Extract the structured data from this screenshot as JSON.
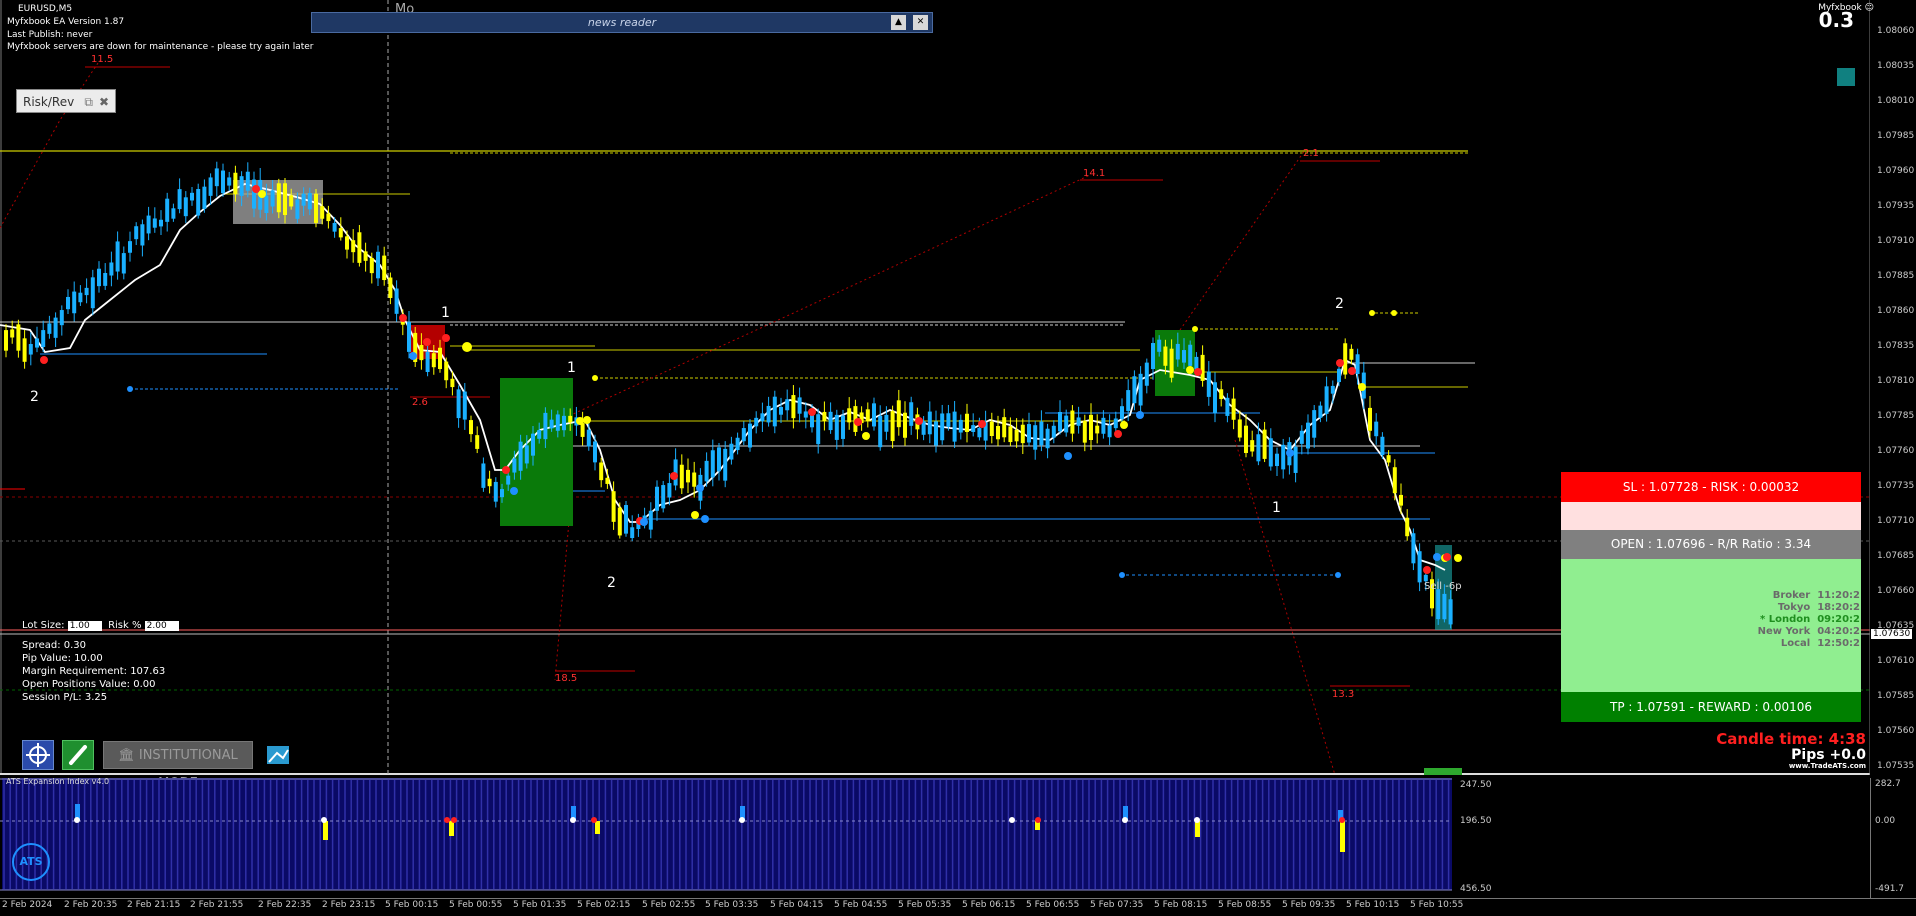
{
  "chart": {
    "symbol_label": "EURUSD,M5",
    "ea_version": "Myfxbook EA Version 1.87",
    "last_publish": "Last Publish: never",
    "maintenance_msg": "Myfxbook servers are down for maintenance - please try again later",
    "top_right_label": "Myfxbook",
    "top_right_value": "0.3",
    "day_label_top": "Mo"
  },
  "news_reader": {
    "title": "news reader",
    "collapse_icon": "triangle-up-icon",
    "close_icon": "close-icon"
  },
  "risk_panel": {
    "title": "Risk/Rev"
  },
  "lot_settings": {
    "lot_size_label": "Lot Size:",
    "lot_size_value": "1.00",
    "risk_label": "Risk %",
    "risk_value": "2.00"
  },
  "account_info": {
    "spread": "Spread: 0.30",
    "pip_value": "Pip Value: 10.00",
    "margin": "Margin Requirement: 107.63",
    "open_positions": "Open Positions Value: 0.00",
    "session_pl": "Session P/L: 3.25"
  },
  "toolbar": {
    "institutional_mode": "INSTITUTIONAL MODE"
  },
  "trade_box": {
    "sl_text": "SL : 1.07728 - RISK : 0.00032",
    "open_text": "OPEN : 1.07696 - R/R Ratio : 3.34",
    "tp_text": "TP : 1.07591 - REWARD : 0.00106",
    "colors": {
      "sl": "#ff0000",
      "sl_light": "#ffe0e0",
      "open": "#808080",
      "tp_light": "#90ee90",
      "tp": "#008000"
    }
  },
  "sessions": [
    {
      "name": "Broker",
      "time": "11:20:2",
      "color": "#6a6a6a"
    },
    {
      "name": "Tokyo",
      "time": "18:20:2",
      "color": "#6a6a6a"
    },
    {
      "name": "* London",
      "time": "09:20:2",
      "color": "#1f8f1f"
    },
    {
      "name": "New York",
      "time": "04:20:2",
      "color": "#6a6a6a"
    },
    {
      "name": "Local",
      "time": "12:50:2",
      "color": "#6a6a6a"
    }
  ],
  "sell_label": "Sell -6p",
  "candle_time": "Candle time:  4:38",
  "pips": "Pips +0.0",
  "ats_url": "www.TradeATS.com",
  "price_axis": [
    "1.08060",
    "1.08035",
    "1.08010",
    "1.07985",
    "1.07960",
    "1.07935",
    "1.07910",
    "1.07885",
    "1.07860",
    "1.07835",
    "1.07810",
    "1.07785",
    "1.07760",
    "1.07735",
    "1.07710",
    "1.07685",
    "1.07660",
    "1.07635",
    "1.07610",
    "1.07585",
    "1.07560",
    "1.07535"
  ],
  "current_price": "1.07630",
  "sub_indicator": {
    "title": "ATS Expansion Index v4.0",
    "levels": [
      "247.50",
      "196.50",
      "456.50"
    ],
    "axis": [
      "282.7",
      "0.00",
      "-491.7"
    ]
  },
  "time_axis": [
    "2 Feb 2024",
    "2 Feb 20:35",
    "2 Feb 21:15",
    "2 Feb 21:55",
    "2 Feb 22:35",
    "2 Feb 23:15",
    "5 Feb 00:15",
    "5 Feb 00:55",
    "5 Feb 01:35",
    "5 Feb 02:15",
    "5 Feb 02:55",
    "5 Feb 03:35",
    "5 Feb 04:15",
    "5 Feb 04:55",
    "5 Feb 05:35",
    "5 Feb 06:15",
    "5 Feb 06:55",
    "5 Feb 07:35",
    "5 Feb 08:15",
    "5 Feb 08:55",
    "5 Feb 09:35",
    "5 Feb 10:15",
    "5 Feb 10:55"
  ],
  "chart_labels": [
    "11.5",
    "14.1",
    "2.1",
    "2.6",
    "18.5",
    "13.3",
    "1",
    "2",
    "1",
    "2",
    "2",
    "1"
  ]
}
